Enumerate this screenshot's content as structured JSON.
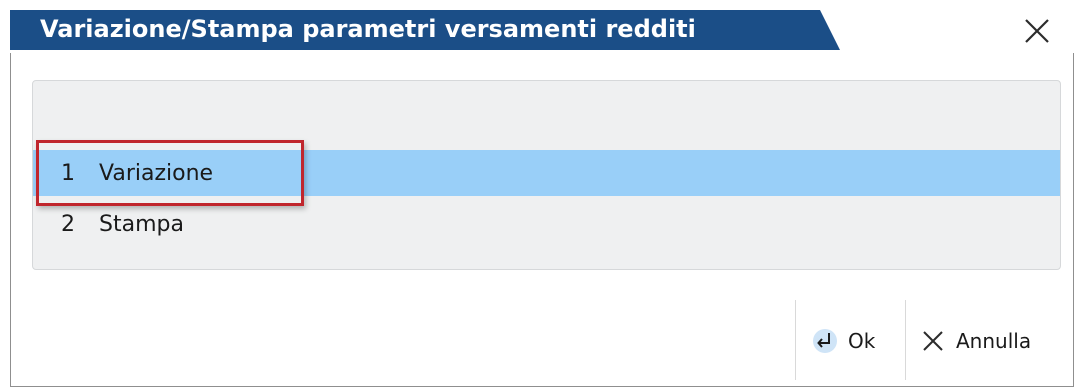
{
  "dialog": {
    "title": "Variazione/Stampa parametri versamenti redditi",
    "close_icon": "close-icon"
  },
  "menu": {
    "items": [
      {
        "number": "1",
        "label": "Variazione",
        "selected": true
      },
      {
        "number": "2",
        "label": "Stampa",
        "selected": false
      }
    ]
  },
  "footer": {
    "ok_label": "Ok",
    "ok_icon": "enter-return-icon",
    "cancel_label": "Annulla",
    "cancel_icon": "close-icon"
  },
  "colors": {
    "title_bar": "#1b4e87",
    "selection": "#99cff8",
    "highlight_box": "#c0262d",
    "panel": "#eff0f1"
  }
}
